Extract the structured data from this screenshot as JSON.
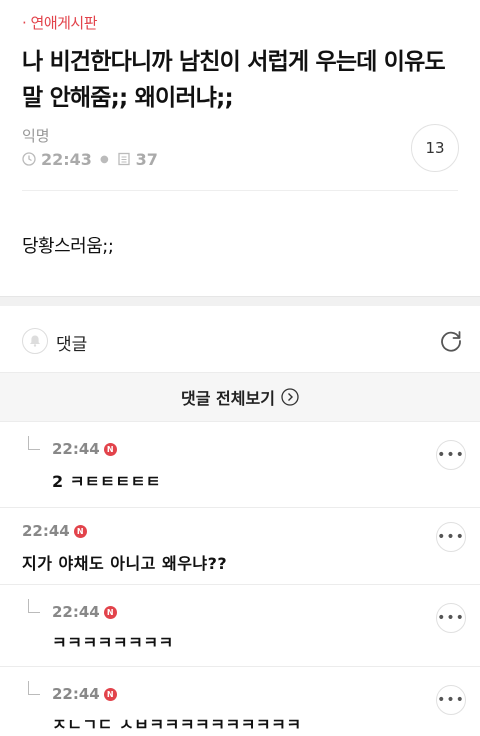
{
  "post": {
    "category": "· 연애게시판",
    "title": "나 비건한다니까 남친이 서럽게 우는데 이유도 말 안해줌;; 왜이러냐;;",
    "author": "익명",
    "time": "22:43",
    "views": "37",
    "comment_count": "13",
    "body": "당황스러움;;"
  },
  "comments_section": {
    "label": "댓글",
    "view_all": "댓글 전체보기"
  },
  "comments": [
    {
      "time": "22:44",
      "badge": "N",
      "text": "2 ㅋㅌㅌㅌㅌㅌ",
      "reply": true
    },
    {
      "time": "22:44",
      "badge": "N",
      "text": "지가 야채도 아니고 왜우냐??",
      "reply": false
    },
    {
      "time": "22:44",
      "badge": "N",
      "text": "ㅋㅋㅋㅋㅋㅋㅋㅋ",
      "reply": true
    },
    {
      "time": "22:44",
      "badge": "N",
      "text": "ㅈㄴㄱㄷ ㅅㅂㅋㅋㅋㅋㅋㅋㅋㅋㅋㅋ",
      "reply": true
    }
  ]
}
